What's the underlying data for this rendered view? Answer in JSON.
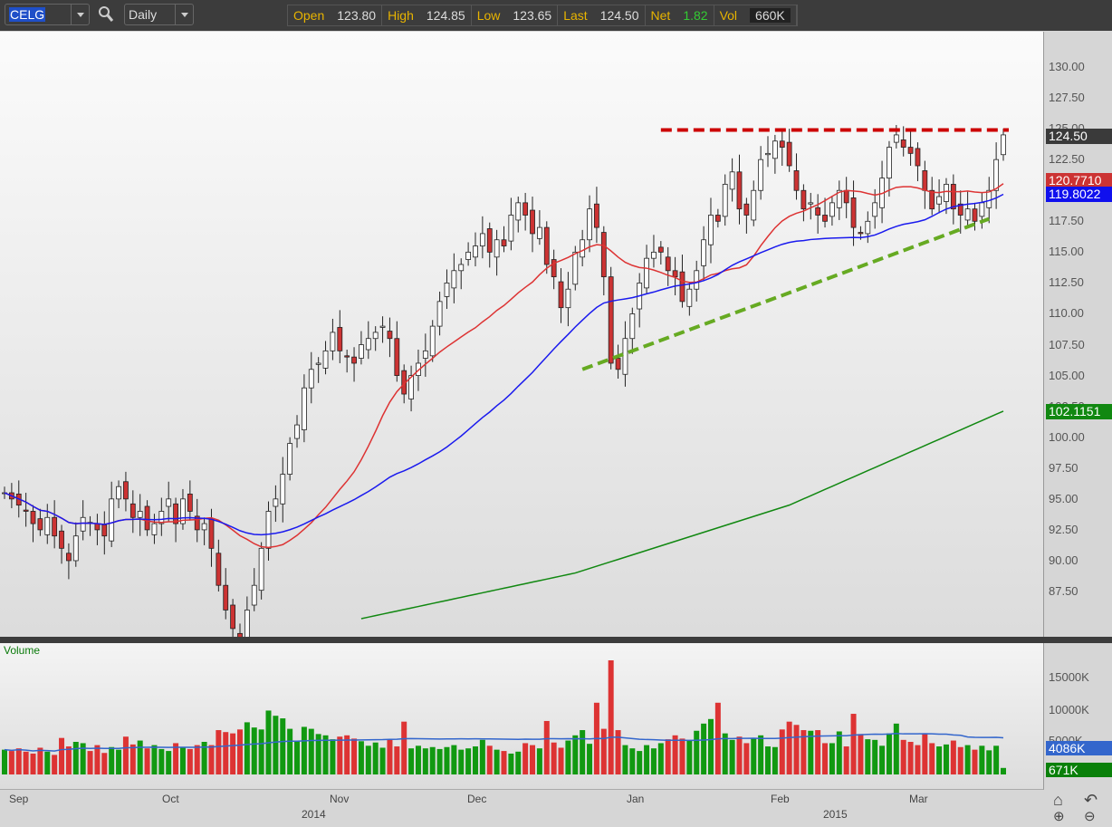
{
  "toolbar": {
    "symbol": "CELG",
    "period": "Daily",
    "quote": [
      {
        "label": "Open",
        "value": "123.80"
      },
      {
        "label": "High",
        "value": "124.85"
      },
      {
        "label": "Low",
        "value": "123.65"
      },
      {
        "label": "Last",
        "value": "124.50"
      },
      {
        "label": "Net",
        "value": "1.82"
      },
      {
        "label": "Vol",
        "value": "660K"
      }
    ]
  },
  "colors": {
    "up": "#ffffff",
    "down": "#cc3333",
    "ma20": "#dd3333",
    "ma50": "#1a1aee",
    "ma200": "#118811",
    "volUp": "#119911",
    "volDown": "#dd3333",
    "resistance": "#cc0000",
    "support": "#66aa22"
  },
  "price_axis": {
    "ticks": [
      "130.00",
      "127.50",
      "125.00",
      "122.50",
      "120.00",
      "117.50",
      "115.00",
      "112.50",
      "110.00",
      "107.50",
      "105.00",
      "102.50",
      "100.00",
      "97.50",
      "95.00",
      "92.50",
      "90.00",
      "87.50"
    ],
    "labels": {
      "last": "124.50",
      "ma20": "120.7710",
      "ma50": "119.8022",
      "ma200": "102.1151"
    }
  },
  "volume_axis": {
    "title": "Volume",
    "ticks": [
      "15000K",
      "10000K",
      "5000K"
    ],
    "labels": {
      "avg": "4086K",
      "last": "671K"
    }
  },
  "x_axis": {
    "months": [
      "Sep",
      "Oct",
      "Nov",
      "Dec",
      "Jan",
      "Feb",
      "Mar"
    ],
    "years": [
      "2014",
      "2015"
    ]
  },
  "chart_data": {
    "type": "candlestick",
    "symbol": "CELG",
    "ylim": [
      85,
      132
    ],
    "close": [
      95.5,
      95,
      94.5,
      94,
      93,
      92.5,
      93.5,
      92,
      91,
      90,
      92,
      93.5,
      93,
      92.5,
      92,
      95,
      96,
      95,
      93.5,
      94,
      92.5,
      93,
      94,
      95,
      93,
      95,
      94,
      92.5,
      93,
      91,
      88,
      86,
      84.5,
      83.5,
      86,
      88,
      91,
      94,
      95,
      97,
      99.5,
      101,
      104,
      105.5,
      106,
      107,
      108.5,
      107,
      106.5,
      106,
      107.5,
      108,
      108.5,
      109,
      108,
      105,
      103.5,
      105,
      106,
      107,
      109,
      111,
      112.5,
      113.5,
      114,
      115,
      115.5,
      116.5,
      115,
      116,
      115.5,
      118,
      119,
      118,
      116.5,
      117,
      114,
      113,
      110.5,
      112,
      115,
      116,
      118.5,
      117,
      113,
      106,
      105.5,
      108,
      110,
      112.5,
      114.5,
      115,
      115,
      113.5,
      113,
      111,
      112,
      113.5,
      116,
      118,
      117.5,
      120.5,
      121.5,
      118.5,
      118,
      120,
      122.5,
      123,
      124,
      123.5,
      122,
      120,
      118.5,
      119,
      118,
      117.5,
      119,
      120,
      119,
      117,
      116.5,
      117.5,
      119,
      121,
      123.5,
      124.5,
      123.5,
      123,
      122,
      120,
      118.5,
      119.5,
      120.5,
      118.5,
      118,
      118.5,
      117.5,
      119,
      120,
      122.5,
      124.5
    ],
    "volume_k": [
      3800,
      3600,
      4000,
      3500,
      3200,
      4100,
      3500,
      3000,
      5600,
      4300,
      5000,
      4800,
      3600,
      4500,
      3300,
      4200,
      3800,
      5800,
      4600,
      5200,
      4000,
      4500,
      3900,
      3600,
      4800,
      4200,
      3900,
      4500,
      5000,
      4500,
      6800,
      6500,
      6300,
      6900,
      8000,
      7200,
      6900,
      9800,
      9000,
      8600,
      7000,
      5200,
      7300,
      7000,
      6200,
      6000,
      5400,
      5800,
      6000,
      5500,
      5100,
      4400,
      4900,
      4100,
      5300,
      4300,
      8100,
      4000,
      4400,
      4000,
      4200,
      3900,
      4200,
      4500,
      3800,
      4000,
      4300,
      5300,
      4400,
      3800,
      3600,
      3200,
      3500,
      4800,
      4500,
      4000,
      8200,
      4900,
      4100,
      5200,
      6000,
      6800,
      4700,
      11000,
      7000,
      17500,
      6800,
      4500,
      4000,
      3600,
      4500,
      4000,
      4800,
      5400,
      6000,
      5500,
      5200,
      6700,
      7800,
      8500,
      11000,
      6300,
      5300,
      5800,
      4800,
      5600,
      6000,
      4300,
      4200,
      6900,
      8100,
      7600,
      6800,
      6700,
      6800,
      4800,
      4800,
      6600,
      4300,
      9300,
      6200,
      5400,
      5300,
      4400,
      6300,
      7800,
      5300,
      5000,
      4500,
      6200,
      4800,
      4300,
      4600,
      5200,
      4200,
      4500,
      3800,
      4400,
      3700,
      4400,
      1000
    ],
    "ma200": [
      [
        50,
        85.3
      ],
      [
        80,
        89
      ],
      [
        110,
        94.5
      ],
      [
        140,
        102.1151
      ]
    ],
    "resistance": {
      "price": 124.9,
      "from_index": 92,
      "to_index": 140
    },
    "support": {
      "from": [
        81,
        105.5
      ],
      "to": [
        138,
        117.7
      ]
    }
  }
}
